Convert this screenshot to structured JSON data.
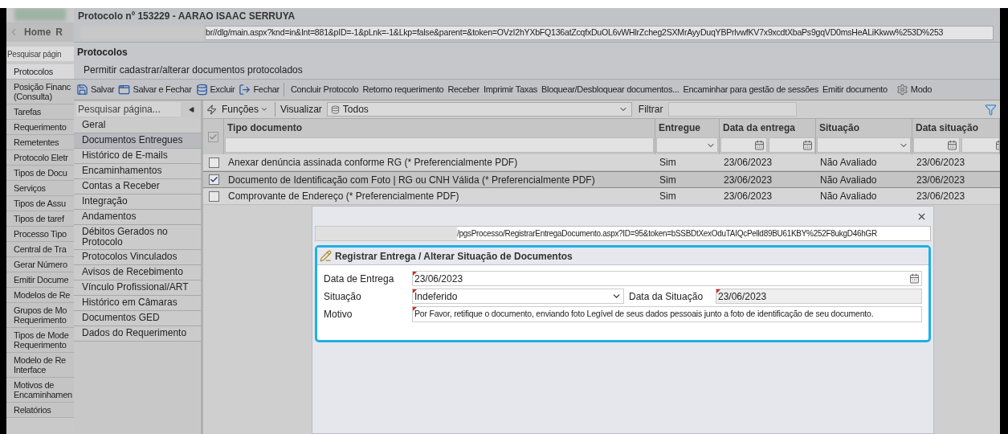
{
  "app_sidebar": {
    "home": "Home",
    "next": "R",
    "search": {
      "placeholder": "Pesquisar págin"
    },
    "items": [
      {
        "label": "Protocolos",
        "selected": true
      },
      {
        "label": "Posição Financ\n(Consulta)",
        "selected": false
      },
      {
        "label": "Tarefas",
        "selected": false
      },
      {
        "label": "Requerimento",
        "selected": false
      },
      {
        "label": "Remetentes",
        "selected": false
      },
      {
        "label": "Protocolo Eletr",
        "selected": false
      },
      {
        "label": "Tipos de Docu",
        "selected": false
      },
      {
        "label": "Serviços",
        "selected": false
      },
      {
        "label": "Tipos de Assu",
        "selected": false
      },
      {
        "label": "Tipos de taref",
        "selected": false
      },
      {
        "label": "Processo Tipo",
        "selected": false
      },
      {
        "label": "Central de Tra",
        "selected": false
      },
      {
        "label": "Gerar Número",
        "selected": false
      },
      {
        "label": "Emitir Docume",
        "selected": false
      },
      {
        "label": "Modelos de Re",
        "selected": false
      },
      {
        "label": "Grupos de Mo\nRequerimento",
        "selected": false
      },
      {
        "label": "Tipos de Mode\nRequerimento",
        "selected": false
      },
      {
        "label": "Modelo de Re\nInterface",
        "selected": false
      },
      {
        "label": "Motivos de\nEncaminhamen",
        "selected": false
      },
      {
        "label": "Relatórios",
        "selected": false
      }
    ]
  },
  "window": {
    "title": "Protocolo nº 153229 - AARAO ISAAC SERRUYA",
    "url": "br//dlg/main.aspx?knd=in&Int=881&pID=-1&pLnk=-1&Lkp=false&parent=&token=OVzI2hYXbFQ136atZcqfxDuOL6vWHlrZcheg2SXMrAyyDuqYBPrlvwfKV7x9xcdtXbaPs9gqVD0msHeALiKkww%253D%253"
  },
  "page": {
    "title": "Protocolos",
    "subtitle": "Permitir cadastrar/alterar documentos protocolados"
  },
  "toolbar": [
    {
      "label": "Salvar",
      "kind": "icon"
    },
    {
      "label": "Salvar e Fechar",
      "kind": "icon"
    },
    {
      "label": "Excluir",
      "kind": "icon"
    },
    {
      "label": "Fechar",
      "kind": "icon"
    },
    {
      "label": "Concluir Protocolo",
      "kind": "text"
    },
    {
      "label": "Retorno requerimento",
      "kind": "text"
    },
    {
      "label": "Receber",
      "kind": "text"
    },
    {
      "label": "Imprimir Taxas",
      "kind": "text"
    },
    {
      "label": "Bloquear/Desbloquear documentos...",
      "kind": "text"
    },
    {
      "label": "Encaminhar para gestão de sessões",
      "kind": "text"
    },
    {
      "label": "Emitir documento",
      "kind": "text"
    },
    {
      "label": "Modo",
      "kind": "gear"
    }
  ],
  "nav": {
    "search": {
      "placeholder": "Pesquisar página..."
    },
    "items": [
      {
        "label": "Geral",
        "selected": false
      },
      {
        "label": "Documentos Entregues",
        "selected": true
      },
      {
        "label": "Histórico de E-mails",
        "selected": false
      },
      {
        "label": "Encaminhamentos",
        "selected": false
      },
      {
        "label": "Contas a Receber",
        "selected": false
      },
      {
        "label": "Integração",
        "selected": false
      },
      {
        "label": "Andamentos",
        "selected": false
      },
      {
        "label": "Débitos Gerados no Protocolo",
        "selected": false
      },
      {
        "label": "Protocolos Vinculados",
        "selected": false
      },
      {
        "label": "Avisos de Recebimento",
        "selected": false
      },
      {
        "label": "Vínculo Profissional/ART",
        "selected": false
      },
      {
        "label": "Histórico em Câmaras",
        "selected": false
      },
      {
        "label": "Documentos GED",
        "selected": false
      },
      {
        "label": "Dados do Requerimento",
        "selected": false
      }
    ]
  },
  "grid": {
    "functions": "Funções",
    "view_label": "Visualizar",
    "view_value": "Todos",
    "filter_label": "Filtrar",
    "select_all": {
      "checked": true,
      "disabled": true
    },
    "columns": [
      {
        "label": "Tipo documento",
        "kind": "text"
      },
      {
        "label": "Entregue",
        "kind": "select"
      },
      {
        "label": "Data da entrega",
        "kind": "date"
      },
      {
        "label": "Situação",
        "kind": "select"
      },
      {
        "label": "Data situação",
        "kind": "date"
      }
    ],
    "rows": [
      {
        "checked": false,
        "selected": false,
        "cells": [
          "Anexar denúncia assinada conforme RG (* Preferencialmente PDF)",
          "Sim",
          "23/06/2023",
          "Não Avaliado",
          "23/06/2023"
        ]
      },
      {
        "checked": true,
        "selected": true,
        "cells": [
          "Documento de Identificação com Foto | RG ou CNH Válida (* Preferencialmente PDF)",
          "Sim",
          "23/06/2023",
          "Não Avaliado",
          "23/06/2023"
        ]
      },
      {
        "checked": false,
        "selected": false,
        "cells": [
          "Comprovante de Endereço (* Preferencialmente PDF)",
          "Sim",
          "23/06/2023",
          "Não Avaliado",
          "23/06/2023"
        ]
      }
    ]
  },
  "dialog": {
    "url": "/pgsProcesso/RegistrarEntregaDocumento.aspx?ID=95&token=bSSBDtXexOduTAIQcPelld89BU61KBY%252F8ukgD46hGR",
    "panel_title": "Registrar Entrega / Alterar Situação de Documentos",
    "delivery_date": {
      "label": "Data de Entrega",
      "value": "23/06/2023"
    },
    "status": {
      "label": "Situação",
      "value": "Indeferido"
    },
    "status_date": {
      "label": "Data da Situação",
      "value": "23/06/2023",
      "disabled": true
    },
    "reason": {
      "label": "Motivo",
      "value": "Por Favor, retifique o documento, enviando foto Legível de seus dados pessoais junto a foto de identificação de seu documento."
    }
  }
}
